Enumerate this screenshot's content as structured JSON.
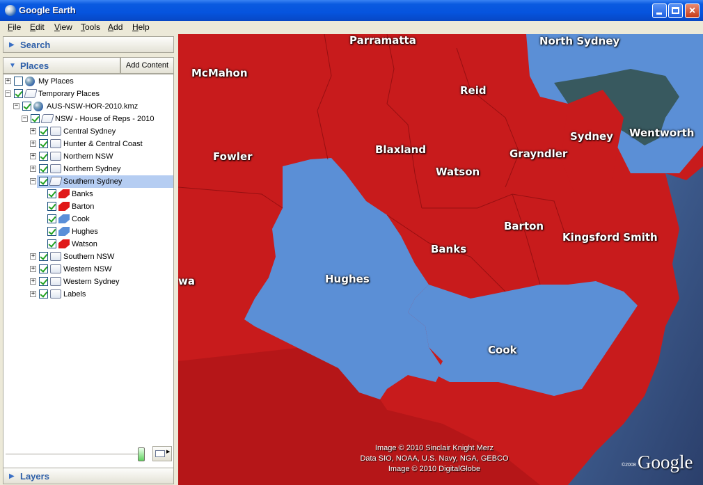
{
  "window": {
    "title": "Google Earth"
  },
  "menu": [
    "File",
    "Edit",
    "View",
    "Tools",
    "Add",
    "Help"
  ],
  "search": {
    "label": "Search"
  },
  "places": {
    "label": "Places",
    "add_content": "Add Content"
  },
  "layers": {
    "label": "Layers"
  },
  "tree": [
    {
      "label": "My Places",
      "level": 0,
      "toggle": "+",
      "checked": false,
      "icon": "globe"
    },
    {
      "label": "Temporary Places",
      "level": 0,
      "toggle": "-",
      "checked": true,
      "icon": "folder-open"
    },
    {
      "label": "AUS-NSW-HOR-2010.kmz",
      "level": 1,
      "toggle": "-",
      "checked": true,
      "icon": "globe"
    },
    {
      "label": "NSW - House of Reps - 2010",
      "level": 2,
      "toggle": "-",
      "checked": true,
      "icon": "folder-open"
    },
    {
      "label": "Central Sydney",
      "level": 3,
      "toggle": "+",
      "checked": true,
      "icon": "folder"
    },
    {
      "label": "Hunter & Central Coast",
      "level": 3,
      "toggle": "+",
      "checked": true,
      "icon": "folder"
    },
    {
      "label": "Northern NSW",
      "level": 3,
      "toggle": "+",
      "checked": true,
      "icon": "folder"
    },
    {
      "label": "Northern Sydney",
      "level": 3,
      "toggle": "+",
      "checked": true,
      "icon": "folder"
    },
    {
      "label": "Southern Sydney",
      "level": 3,
      "toggle": "-",
      "checked": true,
      "icon": "folder-open",
      "selected": true
    },
    {
      "label": "Banks",
      "level": 4,
      "toggle": "",
      "checked": true,
      "icon": "poly-red"
    },
    {
      "label": "Barton",
      "level": 4,
      "toggle": "",
      "checked": true,
      "icon": "poly-red"
    },
    {
      "label": "Cook",
      "level": 4,
      "toggle": "",
      "checked": true,
      "icon": "poly-blue"
    },
    {
      "label": "Hughes",
      "level": 4,
      "toggle": "",
      "checked": true,
      "icon": "poly-blue"
    },
    {
      "label": "Watson",
      "level": 4,
      "toggle": "",
      "checked": true,
      "icon": "poly-red"
    },
    {
      "label": "Southern NSW",
      "level": 3,
      "toggle": "+",
      "checked": true,
      "icon": "folder"
    },
    {
      "label": "Western NSW",
      "level": 3,
      "toggle": "+",
      "checked": true,
      "icon": "folder"
    },
    {
      "label": "Western Sydney",
      "level": 3,
      "toggle": "+",
      "checked": true,
      "icon": "folder"
    },
    {
      "label": "Labels",
      "level": 3,
      "toggle": "+",
      "checked": true,
      "icon": "folder"
    }
  ],
  "map_labels": {
    "parramatta": "Parramatta",
    "north_sydney": "North Sydney",
    "mcmahon": "McMahon",
    "reid": "Reid",
    "sydney": "Sydney",
    "wentworth": "Wentworth",
    "fowler": "Fowler",
    "blaxland": "Blaxland",
    "watson": "Watson",
    "grayndler": "Grayndler",
    "barton": "Barton",
    "kingsford_smith": "Kingsford Smith",
    "banks": "Banks",
    "hughes": "Hughes",
    "cook": "Cook",
    "wa": "wa"
  },
  "credits": [
    "Image © 2010 Sinclair Knight Merz",
    "Data SIO, NOAA, U.S. Navy, NGA, GEBCO",
    "Image © 2010 DigitalGlobe"
  ],
  "brand": {
    "logo": "Google",
    "copyright": "©2008"
  },
  "colors": {
    "labor": "#c81b1c",
    "liberal": "#5b8fd6",
    "water": "#3d5a8a",
    "titlebar": "#0654de"
  }
}
